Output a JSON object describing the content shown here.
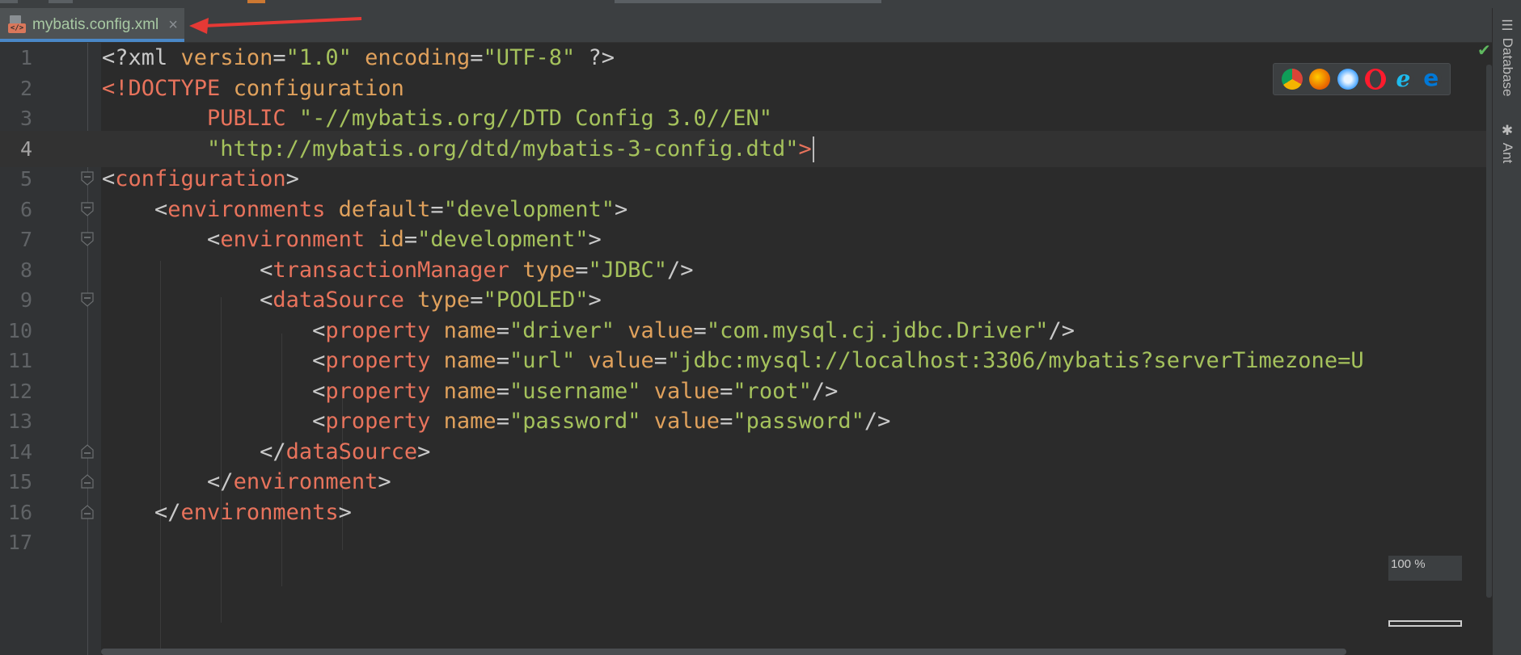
{
  "tab": {
    "filename": "mybatis.config.xml",
    "close": "×"
  },
  "right_panel": {
    "database": "Database",
    "ant": "Ant"
  },
  "zoom": "100 %",
  "browser_icons": [
    "chrome-icon",
    "firefox-icon",
    "safari-icon",
    "opera-icon",
    "ie-icon",
    "edge-icon"
  ],
  "current_line": 4,
  "lines": [
    {
      "n": "1",
      "tokens": [
        [
          "p",
          "<?xml "
        ],
        [
          "a",
          "version"
        ],
        [
          "p",
          "="
        ],
        [
          "s",
          "\"1.0\""
        ],
        [
          "p",
          " "
        ],
        [
          "a",
          "encoding"
        ],
        [
          "p",
          "="
        ],
        [
          "s",
          "\"UTF-8\""
        ],
        [
          "p",
          " ?>"
        ]
      ]
    },
    {
      "n": "2",
      "tokens": [
        [
          "k",
          "<!DOCTYPE "
        ],
        [
          "a",
          "configuration"
        ]
      ]
    },
    {
      "n": "3",
      "tokens": [
        [
          "p",
          "        "
        ],
        [
          "k",
          "PUBLIC "
        ],
        [
          "s",
          "\"-//mybatis.org//DTD Config 3.0//EN\""
        ]
      ]
    },
    {
      "n": "4",
      "tokens": [
        [
          "p",
          "        "
        ],
        [
          "s",
          "\"http://mybatis.org/dtd/mybatis-3-config.dtd\""
        ],
        [
          "k",
          ">"
        ]
      ]
    },
    {
      "n": "5",
      "tokens": [
        [
          "p",
          "<"
        ],
        [
          "t",
          "configuration"
        ],
        [
          "p",
          ">"
        ]
      ]
    },
    {
      "n": "6",
      "tokens": [
        [
          "p",
          "    <"
        ],
        [
          "t",
          "environments"
        ],
        [
          "p",
          " "
        ],
        [
          "a",
          "default"
        ],
        [
          "p",
          "="
        ],
        [
          "s",
          "\"development\""
        ],
        [
          "p",
          ">"
        ]
      ]
    },
    {
      "n": "7",
      "tokens": [
        [
          "p",
          "        <"
        ],
        [
          "t",
          "environment"
        ],
        [
          "p",
          " "
        ],
        [
          "a",
          "id"
        ],
        [
          "p",
          "="
        ],
        [
          "s",
          "\"development\""
        ],
        [
          "p",
          ">"
        ]
      ]
    },
    {
      "n": "8",
      "tokens": [
        [
          "p",
          "            <"
        ],
        [
          "t",
          "transactionManager"
        ],
        [
          "p",
          " "
        ],
        [
          "a",
          "type"
        ],
        [
          "p",
          "="
        ],
        [
          "s",
          "\"JDBC\""
        ],
        [
          "p",
          "/>"
        ]
      ]
    },
    {
      "n": "9",
      "tokens": [
        [
          "p",
          "            <"
        ],
        [
          "t",
          "dataSource"
        ],
        [
          "p",
          " "
        ],
        [
          "a",
          "type"
        ],
        [
          "p",
          "="
        ],
        [
          "s",
          "\"POOLED\""
        ],
        [
          "p",
          ">"
        ]
      ]
    },
    {
      "n": "10",
      "tokens": [
        [
          "p",
          "                <"
        ],
        [
          "t",
          "property"
        ],
        [
          "p",
          " "
        ],
        [
          "a",
          "name"
        ],
        [
          "p",
          "="
        ],
        [
          "s",
          "\"driver\""
        ],
        [
          "p",
          " "
        ],
        [
          "a",
          "value"
        ],
        [
          "p",
          "="
        ],
        [
          "s",
          "\"com.mysql.cj.jdbc.Driver\""
        ],
        [
          "p",
          "/>"
        ]
      ]
    },
    {
      "n": "11",
      "tokens": [
        [
          "p",
          "                <"
        ],
        [
          "t",
          "property"
        ],
        [
          "p",
          " "
        ],
        [
          "a",
          "name"
        ],
        [
          "p",
          "="
        ],
        [
          "s",
          "\"url\""
        ],
        [
          "p",
          " "
        ],
        [
          "a",
          "value"
        ],
        [
          "p",
          "="
        ],
        [
          "s",
          "\"jdbc:mysql://localhost:3306/mybatis?serverTimezone=U"
        ]
      ]
    },
    {
      "n": "12",
      "tokens": [
        [
          "p",
          "                <"
        ],
        [
          "t",
          "property"
        ],
        [
          "p",
          " "
        ],
        [
          "a",
          "name"
        ],
        [
          "p",
          "="
        ],
        [
          "s",
          "\"username\""
        ],
        [
          "p",
          " "
        ],
        [
          "a",
          "value"
        ],
        [
          "p",
          "="
        ],
        [
          "s",
          "\"root\""
        ],
        [
          "p",
          "/>"
        ]
      ]
    },
    {
      "n": "13",
      "tokens": [
        [
          "p",
          "                <"
        ],
        [
          "t",
          "property"
        ],
        [
          "p",
          " "
        ],
        [
          "a",
          "name"
        ],
        [
          "p",
          "="
        ],
        [
          "s",
          "\"password\""
        ],
        [
          "p",
          " "
        ],
        [
          "a",
          "value"
        ],
        [
          "p",
          "="
        ],
        [
          "s",
          "\"password\""
        ],
        [
          "p",
          "/>"
        ]
      ]
    },
    {
      "n": "14",
      "tokens": [
        [
          "p",
          "            </"
        ],
        [
          "t",
          "dataSource"
        ],
        [
          "p",
          ">"
        ]
      ]
    },
    {
      "n": "15",
      "tokens": [
        [
          "p",
          "        </"
        ],
        [
          "t",
          "environment"
        ],
        [
          "p",
          ">"
        ]
      ]
    },
    {
      "n": "16",
      "tokens": [
        [
          "p",
          "    </"
        ],
        [
          "t",
          "environments"
        ],
        [
          "p",
          ">"
        ]
      ]
    },
    {
      "n": "17",
      "tokens": []
    }
  ]
}
